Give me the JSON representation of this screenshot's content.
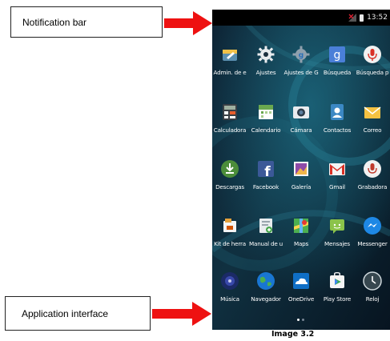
{
  "callouts": {
    "notification_bar": "Notification bar",
    "application_interface": "Application interface"
  },
  "status_bar": {
    "time": "13:52"
  },
  "apps": [
    {
      "label": "Admin. de e",
      "icon": "admin-device-icon"
    },
    {
      "label": "Ajustes",
      "icon": "settings-gear-icon"
    },
    {
      "label": "Ajustes de G",
      "icon": "google-settings-icon"
    },
    {
      "label": "Búsqueda",
      "icon": "google-search-icon"
    },
    {
      "label": "Búsqueda p",
      "icon": "voice-search-icon"
    },
    {
      "label": "Calculadora",
      "icon": "calculator-icon"
    },
    {
      "label": "Calendario",
      "icon": "calendar-icon"
    },
    {
      "label": "Cámara",
      "icon": "camera-icon"
    },
    {
      "label": "Contactos",
      "icon": "contacts-icon"
    },
    {
      "label": "Correo",
      "icon": "email-icon"
    },
    {
      "label": "Descargas",
      "icon": "downloads-icon"
    },
    {
      "label": "Facebook",
      "icon": "facebook-icon"
    },
    {
      "label": "Galería",
      "icon": "gallery-icon"
    },
    {
      "label": "Gmail",
      "icon": "gmail-icon"
    },
    {
      "label": "Grabadora",
      "icon": "recorder-icon"
    },
    {
      "label": "Kit de herra",
      "icon": "toolkit-icon"
    },
    {
      "label": "Manual de u",
      "icon": "user-manual-icon"
    },
    {
      "label": "Maps",
      "icon": "maps-icon"
    },
    {
      "label": "Mensajes",
      "icon": "messages-icon"
    },
    {
      "label": "Messenger",
      "icon": "messenger-icon"
    },
    {
      "label": "Música",
      "icon": "music-icon"
    },
    {
      "label": "Navegador",
      "icon": "browser-globe-icon"
    },
    {
      "label": "OneDrive",
      "icon": "onedrive-icon"
    },
    {
      "label": "Play Store",
      "icon": "play-store-icon"
    },
    {
      "label": "Reloj",
      "icon": "clock-icon"
    }
  ],
  "pager": {
    "pages": 2,
    "current": 1
  },
  "caption": "Image 3.2",
  "colors": {
    "arrow": "#ee1111",
    "status_bar": "#000000",
    "wallpaper_dark": "#0b1b2b",
    "wallpaper_teal": "#1d6f86"
  }
}
